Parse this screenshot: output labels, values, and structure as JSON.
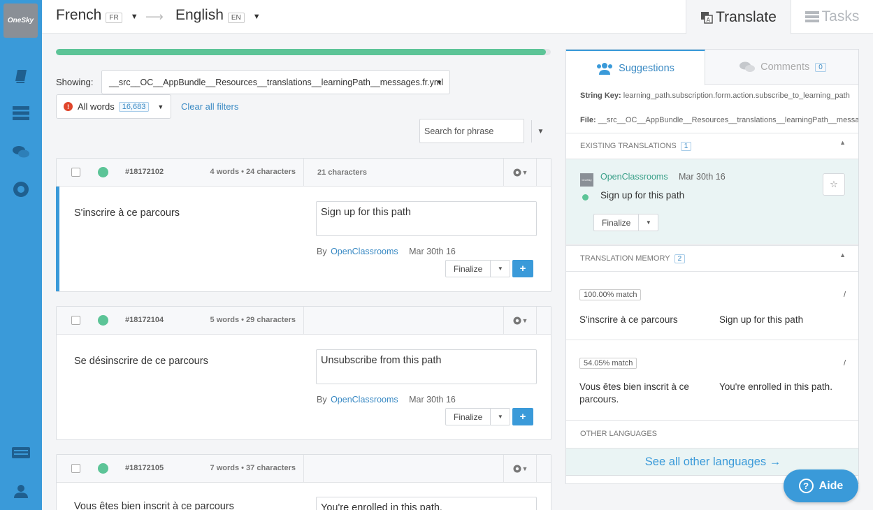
{
  "app": {
    "logo_text": "OneSky"
  },
  "header": {
    "source_lang": "French",
    "source_code": "FR",
    "target_lang": "English",
    "target_code": "EN",
    "tab_translate": "Translate",
    "tab_tasks": "Tasks"
  },
  "progress": {
    "percent": 99
  },
  "filters": {
    "showing_label": "Showing:",
    "file": "__src__OC__AppBundle__Resources__translations__learningPath__messages.fr.yml",
    "all_words": "All words",
    "word_count": "16,683",
    "clear_filters": "Clear all filters",
    "search_placeholder": "Search for phrase"
  },
  "strings": [
    {
      "id": "#18172102",
      "counts": "4 words • 24 characters",
      "char_count": "21 characters",
      "source": "S'inscrire à ce parcours",
      "target": "Sign up for this path",
      "by": "By",
      "author": "OpenClassrooms",
      "date": "Mar 30th 16",
      "finalize": "Finalize",
      "plus": "+"
    },
    {
      "id": "#18172104",
      "counts": "5 words • 29 characters",
      "char_count": "",
      "source": "Se désinscrire de ce parcours",
      "target": "Unsubscribe from this path",
      "by": "By",
      "author": "OpenClassrooms",
      "date": "Mar 30th 16",
      "finalize": "Finalize",
      "plus": "+"
    },
    {
      "id": "#18172105",
      "counts": "7 words • 37 characters",
      "char_count": "",
      "source": "Vous êtes bien inscrit à ce parcours",
      "target": "You're enrolled in this path."
    }
  ],
  "panel": {
    "tab_suggestions": "Suggestions",
    "tab_comments": "Comments",
    "comments_count": "0",
    "string_key_label": "String Key:",
    "string_key": "learning_path.subscription.form.action.subscribe_to_learning_path",
    "file_label": "File:",
    "file": "__src__OC__AppBundle__Resources__translations__learningPath__messages.fr.yml",
    "existing_label": "EXISTING TRANSLATIONS",
    "existing_count": "1",
    "existing": {
      "logo_text": "OneSky",
      "author": "OpenClassrooms",
      "date": "Mar 30th 16",
      "text": "Sign up for this path",
      "finalize": "Finalize"
    },
    "tm_label": "TRANSLATION MEMORY",
    "tm_count": "2",
    "tm": [
      {
        "match": "100.00% match",
        "slash": "/",
        "source": "S'inscrire à ce parcours",
        "target": "Sign up for this path"
      },
      {
        "match": "54.05% match",
        "slash": "/",
        "source": "Vous êtes bien inscrit à ce parcours.",
        "target": "You're enrolled in this path."
      }
    ],
    "other_label": "OTHER LANGUAGES",
    "see_all": "See all other languages →"
  },
  "help": {
    "label": "Aide",
    "icon": "?"
  }
}
